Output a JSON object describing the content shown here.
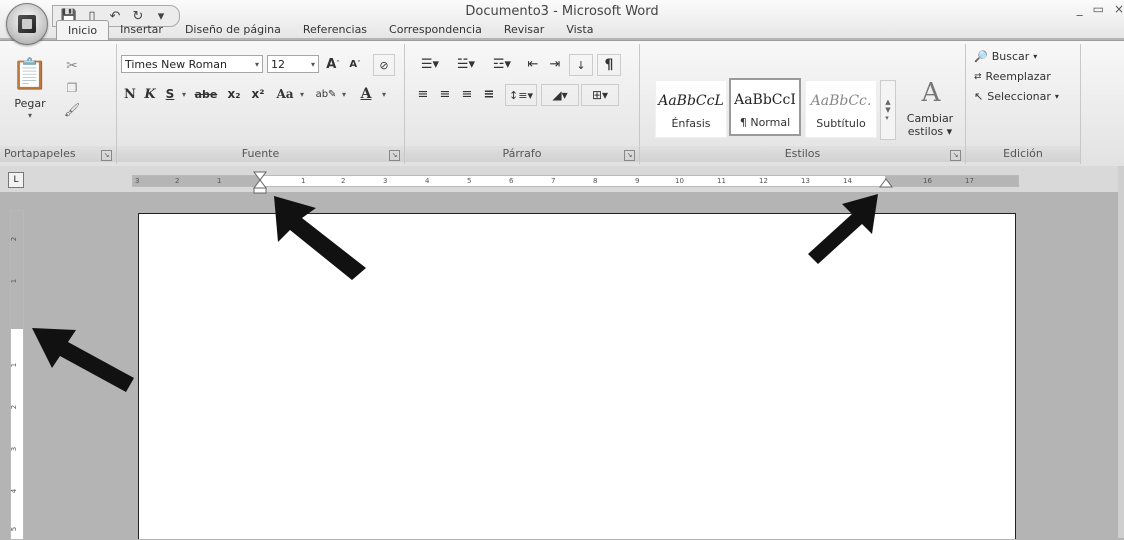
{
  "window": {
    "title": "Documento3 - Microsoft Word",
    "controls": [
      "_",
      "▭",
      "×"
    ]
  },
  "quick_access": {
    "save_icon": "save-icon",
    "new_icon": "new-document-icon",
    "undo_icon": "undo-icon",
    "redo_icon": "redo-icon",
    "customize_glyph": "▾"
  },
  "tabs": [
    "Inicio",
    "Insertar",
    "Diseño de página",
    "Referencias",
    "Correspondencia",
    "Revisar",
    "Vista"
  ],
  "active_tab": "Inicio",
  "clipboard": {
    "label": "Portapapeles",
    "paste": "Pegar"
  },
  "font": {
    "label": "Fuente",
    "family": "Times New Roman",
    "size": "12",
    "bold": "N",
    "italic": "K",
    "underline": "S",
    "strike": "abe",
    "subscript": "x₂",
    "superscript": "x²",
    "change_case": "Aa",
    "grow": "A",
    "shrink": "A"
  },
  "paragraph": {
    "label": "Párrafo",
    "pilcrow": "¶"
  },
  "styles": {
    "label": "Estilos",
    "items": [
      {
        "sample": "AaBbCcL",
        "name": "Énfasis"
      },
      {
        "sample": "AaBbCcI",
        "name": "¶ Normal"
      },
      {
        "sample": "AaBbCc.",
        "name": "Subtítulo"
      }
    ],
    "change_styles_1": "Cambiar",
    "change_styles_2": "estilos"
  },
  "editing": {
    "label": "Edición",
    "find": "Buscar",
    "replace": "Reemplazar",
    "select": "Seleccionar"
  },
  "ruler": {
    "tab_selector": "L",
    "h_numbers_left": [
      "3",
      "2",
      "1"
    ],
    "h_numbers_right": [
      "1",
      "2",
      "3",
      "4",
      "5",
      "6",
      "7",
      "8",
      "9",
      "10",
      "11",
      "12",
      "13",
      "14",
      "16",
      "17"
    ],
    "v_numbers": [
      "2",
      "1",
      "1",
      "2",
      "3",
      "4",
      "5"
    ]
  },
  "colors": {
    "ribbon_bg": "#e9e9e9",
    "arrow": "#111111",
    "page": "#ffffff",
    "workspace": "#b4b4b4"
  }
}
